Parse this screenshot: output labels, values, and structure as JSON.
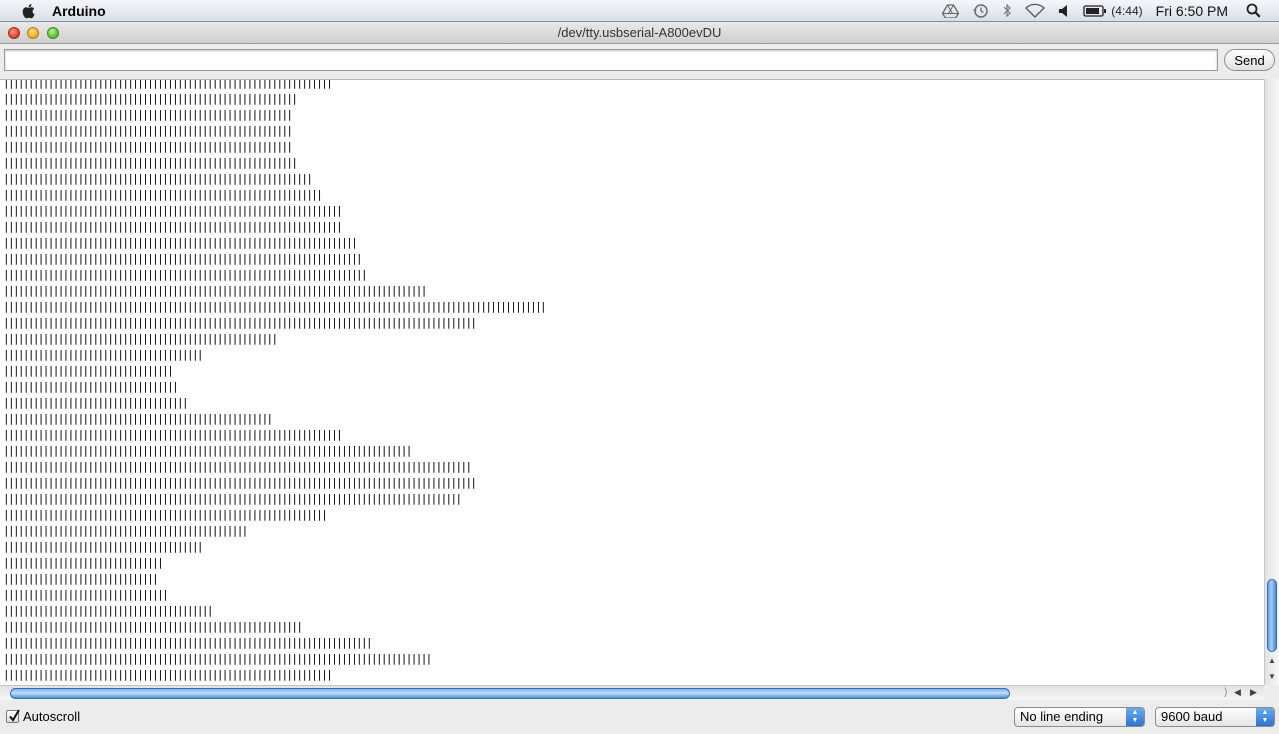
{
  "menubar": {
    "app_name": "Arduino",
    "battery_text": "(4:44)",
    "clock": "Fri 6:50 PM",
    "icons": [
      "apple-icon",
      "google-drive-icon",
      "time-machine-icon",
      "bluetooth-icon",
      "wifi-icon",
      "volume-icon",
      "battery-icon",
      "spotlight-icon"
    ]
  },
  "window": {
    "title": "/dev/tty.usbserial-A800evDU"
  },
  "send_bar": {
    "input_value": "",
    "send_label": "Send"
  },
  "serial": {
    "bar_character": "|",
    "line_lengths": [
      66,
      59,
      58,
      58,
      58,
      59,
      62,
      64,
      68,
      68,
      71,
      72,
      73,
      85,
      109,
      95,
      55,
      40,
      34,
      35,
      37,
      54,
      68,
      82,
      94,
      95,
      92,
      65,
      49,
      40,
      32,
      31,
      33,
      42,
      60,
      74,
      86,
      66
    ]
  },
  "bottom_bar": {
    "autoscroll_label": "Autoscroll",
    "autoscroll_checked": true,
    "line_ending_selected": "No line ending",
    "baud_selected": "9600 baud"
  },
  "colors": {
    "scroll_thumb": "#5fa0e3",
    "select_accent": "#2d72d2"
  }
}
